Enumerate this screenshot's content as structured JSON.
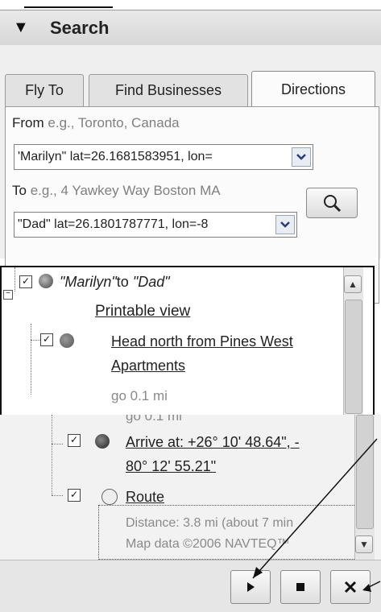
{
  "panel": {
    "title": "Search",
    "toggle_icon": "triangle-down-icon"
  },
  "tabs": [
    {
      "label": "Fly To",
      "active": false
    },
    {
      "label": "Find Businesses",
      "active": false
    },
    {
      "label": "Directions",
      "active": true
    }
  ],
  "directions": {
    "from_label": "From",
    "from_hint": "e.g., Toronto, Canada",
    "from_value": "'Marilyn\" lat=26.1681583951, lon=",
    "to_label": "To",
    "to_hint": "e.g., 4 Yawkey Way Boston MA",
    "to_value": "\"Dad\" lat=26.1801787771, lon=-8",
    "search_icon": "magnifier-icon"
  },
  "results": {
    "header_from": "\"Marilyn\"",
    "header_to_word": "to",
    "header_to": "\"Dad\"",
    "printable": "Printable view",
    "step1_line1": "Head north from Pines West",
    "step1_line2": "Apartments",
    "step1_distance": "go 0.1 mi",
    "step1_distance_repeat": "go 0.1 mi",
    "step2_line1": "Arrive at: +26° 10' 48.64\", -",
    "step2_line2": "80° 12' 55.21\"",
    "route_label": "Route",
    "route_distance": "Distance: 3.8 mi (about 7 min",
    "route_mapdata": "Map data ©2006 NAVTEQ™"
  },
  "controls": {
    "play_icon": "play-icon",
    "stop_icon": "stop-icon",
    "close_icon": "close-icon"
  },
  "colors": {
    "header_bg": "#dcdcdc",
    "tab_bg": "#e2e2e2",
    "panel_bg": "#f2f2f2"
  }
}
